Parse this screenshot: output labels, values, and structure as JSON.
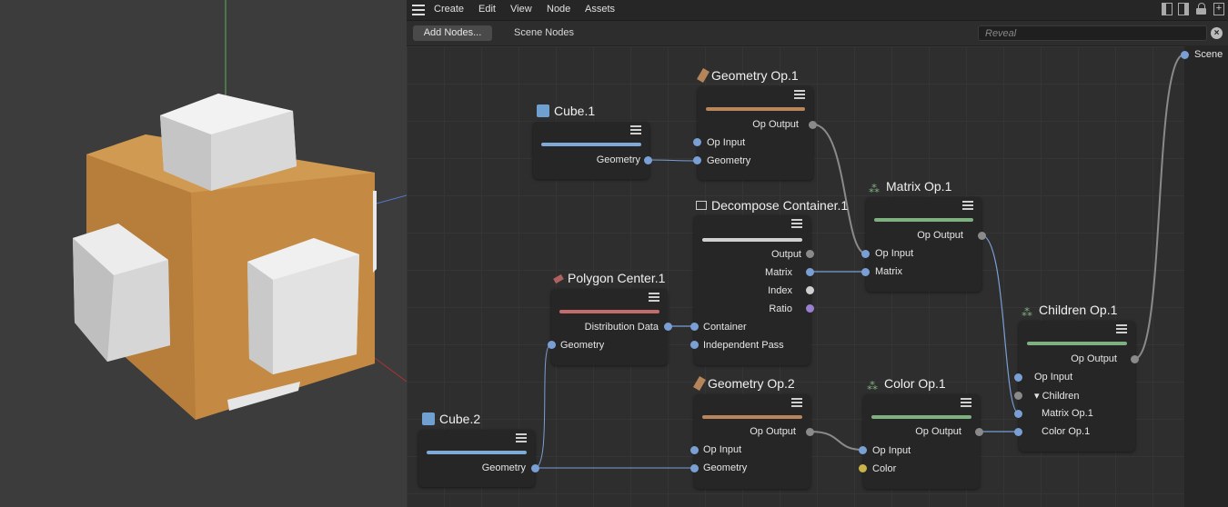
{
  "menu": {
    "items": [
      "Create",
      "Edit",
      "View",
      "Node",
      "Assets"
    ]
  },
  "toolbar": {
    "add_nodes": "Add Nodes...",
    "tab": "Scene Nodes",
    "search_placeholder": "Reveal"
  },
  "colors": {
    "blue_bar": "#7fa9d6",
    "orange_bar": "#b8865a",
    "green_bar": "#7fb07f",
    "red_bar": "#c46b6b",
    "white_bar": "#d0d0d0",
    "port_blue": "#7a9fd4"
  },
  "nodes": {
    "cube1": {
      "title": "Cube.1",
      "ports": {
        "geometry": "Geometry"
      }
    },
    "geo_op1": {
      "title": "Geometry Op.1",
      "ports": {
        "op_output": "Op Output",
        "op_input": "Op Input",
        "geometry": "Geometry"
      }
    },
    "decompose": {
      "title": "Decompose Container.1",
      "ports": {
        "output": "Output",
        "matrix": "Matrix",
        "index": "Index",
        "ratio": "Ratio",
        "container": "Container",
        "independent_pass": "Independent Pass"
      }
    },
    "matrix_op": {
      "title": "Matrix Op.1",
      "ports": {
        "op_output": "Op Output",
        "op_input": "Op Input",
        "matrix": "Matrix"
      }
    },
    "polygon_center": {
      "title": "Polygon Center.1",
      "ports": {
        "distribution_data": "Distribution Data",
        "geometry": "Geometry"
      }
    },
    "children_op": {
      "title": "Children Op.1",
      "ports": {
        "op_output": "Op Output",
        "op_input": "Op Input",
        "children": "Children",
        "matrix_op": "Matrix Op.1",
        "color_op": "Color Op.1"
      }
    },
    "geo_op2": {
      "title": "Geometry Op.2",
      "ports": {
        "op_output": "Op Output",
        "op_input": "Op Input",
        "geometry": "Geometry"
      }
    },
    "color_op": {
      "title": "Color Op.1",
      "ports": {
        "op_output": "Op Output",
        "op_input": "Op Input",
        "color": "Color"
      }
    },
    "cube2": {
      "title": "Cube.2",
      "ports": {
        "geometry": "Geometry"
      }
    },
    "scene": {
      "title": "Scene"
    }
  }
}
